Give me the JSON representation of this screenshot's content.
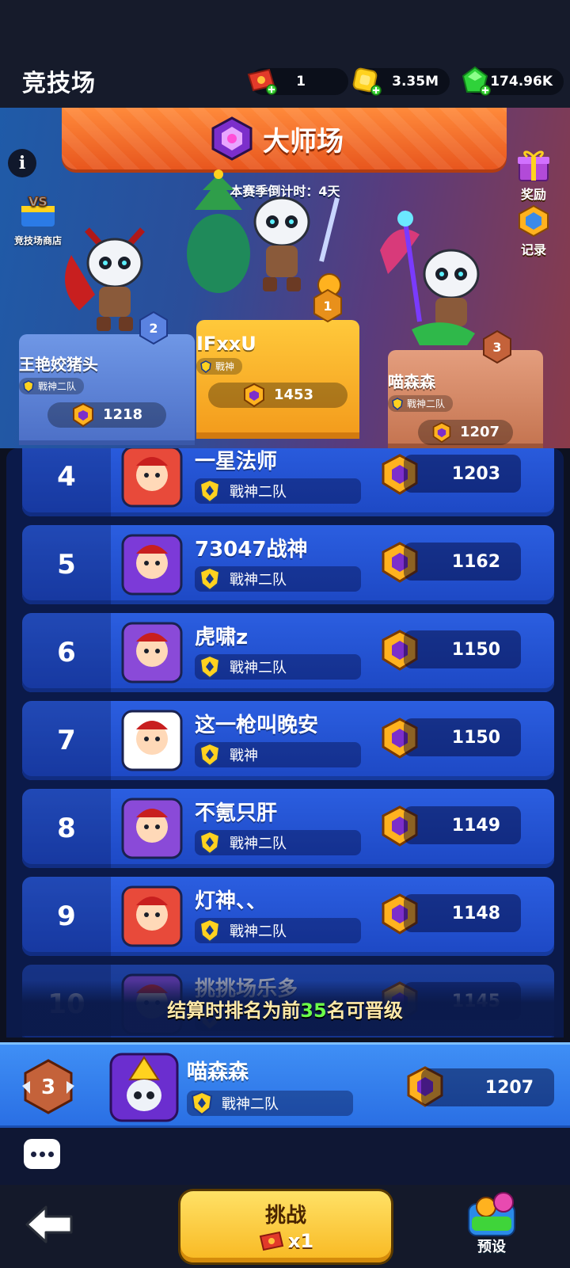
{
  "header": {
    "title": "竞技场",
    "tickets": "1",
    "gold": "3.35M",
    "gems": "174.96K"
  },
  "hero": {
    "league_name": "大师场",
    "countdown": "本赛季倒计时：4天",
    "shop_label": "竞技场商店",
    "reward_label": "奖励",
    "record_label": "记录"
  },
  "podium": {
    "first": {
      "rank": "1",
      "name": "IFxxU",
      "team": "戰神",
      "score": "1453"
    },
    "second": {
      "rank": "2",
      "name": "王艳姣猪头",
      "team": "戰神二队",
      "score": "1218"
    },
    "third": {
      "rank": "3",
      "name": "喵森森",
      "team": "戰神二队",
      "score": "1207"
    }
  },
  "list": [
    {
      "rank": "4",
      "name": "一星法师",
      "team": "戰神二队",
      "score": "1203"
    },
    {
      "rank": "5",
      "name": "73047战神",
      "team": "戰神二队",
      "score": "1162"
    },
    {
      "rank": "6",
      "name": "虎啸z",
      "team": "戰神二队",
      "score": "1150"
    },
    {
      "rank": "7",
      "name": "这一枪叫晚安",
      "team": "戰神",
      "score": "1150"
    },
    {
      "rank": "8",
      "name": "不氪只肝",
      "team": "戰神二队",
      "score": "1149"
    },
    {
      "rank": "9",
      "name": "灯神、、",
      "team": "戰神二队",
      "score": "1148"
    },
    {
      "rank": "10",
      "name": "挑挑场乐多",
      "team": "",
      "score": "1145"
    }
  ],
  "promo": {
    "pre": "结算时排名为前",
    "num": "35",
    "post": "名可晋级"
  },
  "me": {
    "rank": "3",
    "name": "喵森森",
    "team": "戰神二队",
    "score": "1207"
  },
  "bottom": {
    "challenge_label": "挑战",
    "challenge_cost": "x1",
    "preset_label": "预设"
  },
  "colors": {
    "accent": "#f8b821",
    "list_row": "#2b5ee0",
    "header_band": "#ff8a3b"
  }
}
